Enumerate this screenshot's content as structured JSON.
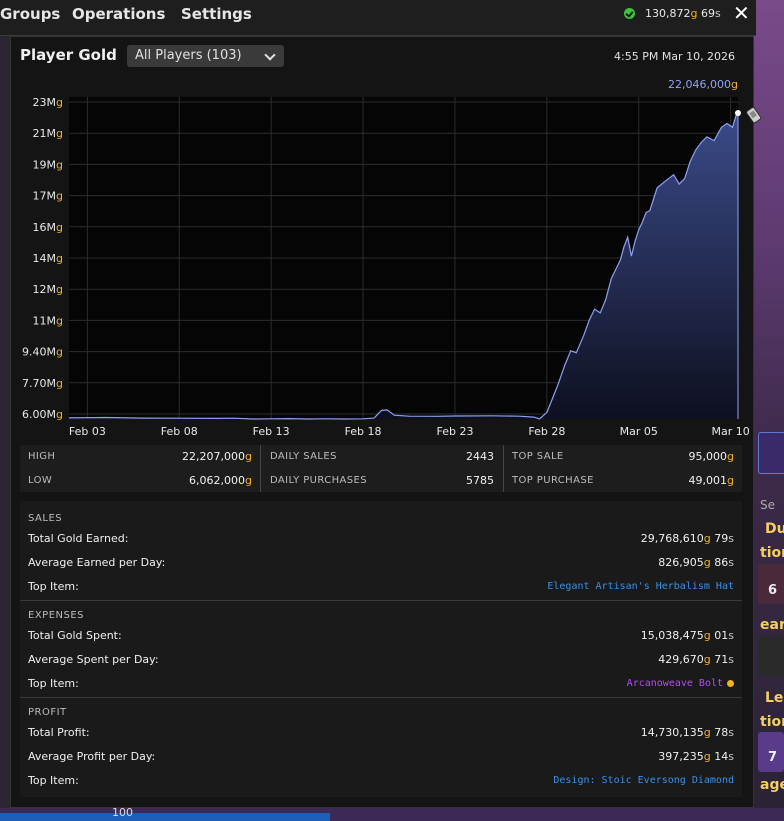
{
  "menubar": {
    "items": [
      "Groups",
      "Operations",
      "Settings"
    ],
    "gold_amount": "130,872",
    "gold_unit": "g",
    "silver_amount": "69",
    "silver_unit": "s",
    "close_label": "✕"
  },
  "panel": {
    "title": "Player Gold",
    "player_filter": "All Players (103)",
    "timestamp": "4:55 PM Mar 10, 2026",
    "current_value": "22,046,000",
    "current_unit": "g"
  },
  "chart_data": {
    "type": "area",
    "title": "",
    "y_tick_labels": [
      "23Mg",
      "21Mg",
      "19Mg",
      "17Mg",
      "16Mg",
      "14Mg",
      "12Mg",
      "11Mg",
      "9.40Mg",
      "7.70Mg",
      "6.00Mg"
    ],
    "x_tick_labels": [
      "Feb 03",
      "Feb 08",
      "Feb 13",
      "Feb 18",
      "Feb 23",
      "Feb 28",
      "Mar 05",
      "Mar 10"
    ],
    "x_tick_days": [
      3,
      8,
      13,
      18,
      23,
      28,
      33,
      38
    ],
    "ylim": [
      6.0,
      23.0
    ],
    "xlim": [
      2.0,
      38.4
    ],
    "grid": true,
    "series": [
      {
        "points": [
          [
            2.0,
            6.06
          ],
          [
            4.0,
            6.08
          ],
          [
            6.0,
            6.05
          ],
          [
            8.0,
            6.04
          ],
          [
            10.0,
            6.03
          ],
          [
            11.0,
            6.04
          ],
          [
            12.0,
            6.0
          ],
          [
            13.0,
            6.01
          ],
          [
            14.0,
            6.02
          ],
          [
            15.0,
            6.0
          ],
          [
            16.0,
            6.01
          ],
          [
            17.0,
            6.0
          ],
          [
            18.0,
            6.01
          ],
          [
            18.6,
            6.05
          ],
          [
            19.0,
            6.45
          ],
          [
            19.3,
            6.48
          ],
          [
            19.7,
            6.2
          ],
          [
            20.5,
            6.15
          ],
          [
            22.0,
            6.14
          ],
          [
            23.0,
            6.16
          ],
          [
            25.0,
            6.17
          ],
          [
            26.5,
            6.15
          ],
          [
            27.3,
            6.1
          ],
          [
            27.6,
            6.0
          ],
          [
            28.0,
            6.35
          ],
          [
            28.6,
            7.8
          ],
          [
            29.0,
            8.9
          ],
          [
            29.3,
            9.6
          ],
          [
            29.6,
            9.5
          ],
          [
            30.0,
            10.4
          ],
          [
            30.3,
            11.2
          ],
          [
            30.6,
            11.8
          ],
          [
            30.9,
            11.6
          ],
          [
            31.2,
            12.3
          ],
          [
            31.5,
            13.4
          ],
          [
            31.8,
            14.0
          ],
          [
            32.0,
            14.4
          ],
          [
            32.2,
            15.1
          ],
          [
            32.4,
            15.6
          ],
          [
            32.6,
            14.6
          ],
          [
            32.8,
            15.4
          ],
          [
            33.0,
            16.0
          ],
          [
            33.2,
            16.4
          ],
          [
            33.4,
            16.9
          ],
          [
            33.6,
            17.0
          ],
          [
            34.0,
            18.2
          ],
          [
            34.5,
            18.6
          ],
          [
            34.9,
            18.9
          ],
          [
            35.2,
            18.4
          ],
          [
            35.5,
            18.7
          ],
          [
            35.8,
            19.6
          ],
          [
            36.1,
            20.2
          ],
          [
            36.4,
            20.6
          ],
          [
            36.7,
            20.9
          ],
          [
            37.1,
            20.7
          ],
          [
            37.5,
            21.4
          ],
          [
            37.8,
            21.6
          ],
          [
            38.1,
            21.4
          ],
          [
            38.3,
            22.05
          ],
          [
            38.4,
            22.05
          ]
        ]
      }
    ],
    "colors": {
      "line": "#8aa2f5",
      "fill_top": "#3b4a88",
      "fill_bottom": "#0e1020"
    }
  },
  "stats": {
    "high_label": "HIGH",
    "high_value": "22,207,000",
    "low_label": "LOW",
    "low_value": "6,062,000",
    "daily_sales_label": "DAILY SALES",
    "daily_sales_value": "2443",
    "daily_purchases_label": "DAILY PURCHASES",
    "daily_purchases_value": "5785",
    "top_sale_label": "TOP SALE",
    "top_sale_value": "95,000",
    "top_purchase_label": "TOP PURCHASE",
    "top_purchase_value": "49,001",
    "unit": "g"
  },
  "sales": {
    "heading": "SALES",
    "total_label": "Total Gold Earned:",
    "total_gold": "29,768,610",
    "total_silver": "79",
    "avg_label": "Average Earned per Day:",
    "avg_gold": "826,905",
    "avg_silver": "86",
    "top_label": "Top Item:",
    "top_item": "Elegant Artisan's Herbalism Hat"
  },
  "expenses": {
    "heading": "EXPENSES",
    "total_label": "Total Gold Spent:",
    "total_gold": "15,038,475",
    "total_silver": "01",
    "avg_label": "Average Spent per Day:",
    "avg_gold": "429,670",
    "avg_silver": "71",
    "top_label": "Top Item:",
    "top_item": "Arcanoweave Bolt"
  },
  "profit": {
    "heading": "PROFIT",
    "total_label": "Total Profit:",
    "total_gold": "14,730,135",
    "total_silver": "78",
    "avg_label": "Average Profit per Day:",
    "avg_gold": "397,235",
    "avg_silver": "14",
    "top_label": "Top Item:",
    "top_item": "Design: Stoic Eversong Diamond"
  },
  "units": {
    "gold": "g",
    "silver": "s"
  },
  "background": {
    "texts": [
      "Du",
      "tion",
      "6",
      "eart",
      "Le",
      "tion",
      "7",
      "age",
      "Se"
    ],
    "bottom_number": "100"
  }
}
